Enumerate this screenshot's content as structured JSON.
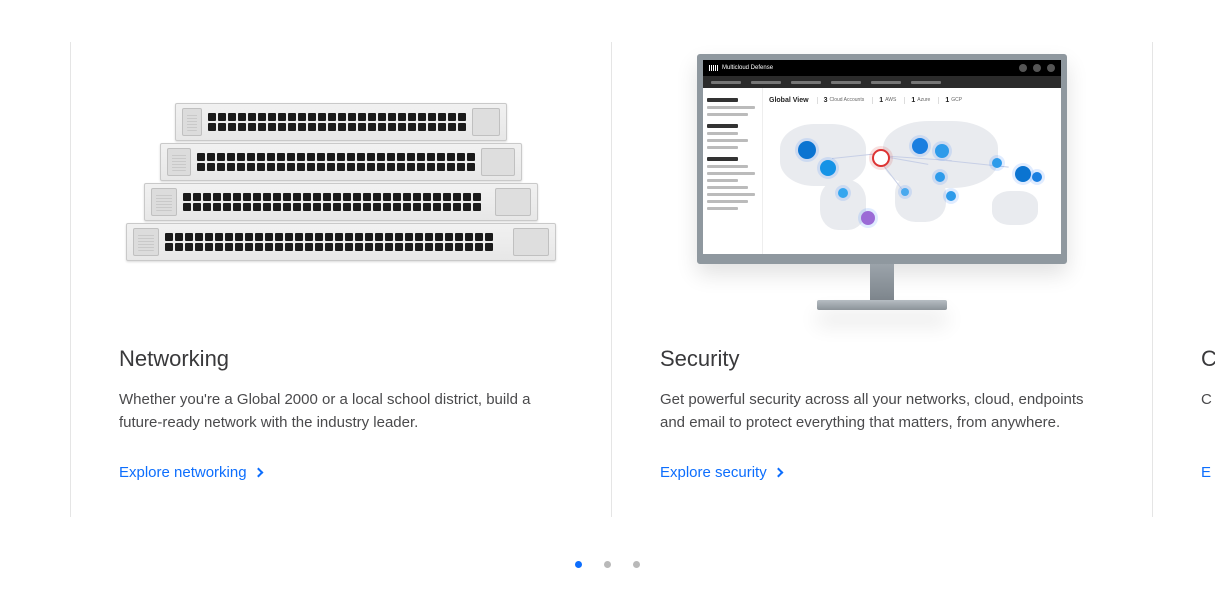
{
  "cards": [
    {
      "title": "Networking",
      "description": "Whether you're a Global 2000 or a local school district, build a future-ready network with the industry leader.",
      "link_label": "Explore networking",
      "image": "switch-stack"
    },
    {
      "title": "Security",
      "description": "Get powerful security across all your networks, cloud, endpoints and email to protect everything that matters, from anywhere.",
      "link_label": "Explore security",
      "image": "monitor-dashboard",
      "dashboard": {
        "brand": "Multicloud Defense",
        "view_title": "Global View",
        "stats": [
          {
            "n": "3",
            "label": "Cloud Accounts"
          },
          {
            "n": "1",
            "label": "AWS"
          },
          {
            "n": "1",
            "label": "Azure"
          },
          {
            "n": "1",
            "label": "GCP"
          }
        ]
      }
    },
    {
      "title": "C",
      "description": "C in b",
      "link_label": "E",
      "image": "none"
    }
  ],
  "pagination": {
    "count": 3,
    "active_index": 0
  },
  "colors": {
    "link": "#0d6efd"
  }
}
